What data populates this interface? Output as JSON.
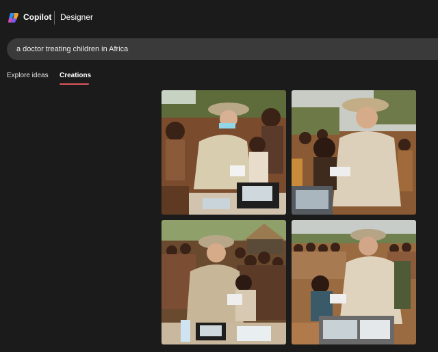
{
  "header": {
    "brand": "Copilot",
    "product": "Designer"
  },
  "prompt": {
    "value": "a doctor treating children in Africa"
  },
  "tabs": [
    {
      "label": "Explore ideas",
      "active": false
    },
    {
      "label": "Creations",
      "active": true
    }
  ],
  "accent_color": "#e0585e",
  "images": [
    {
      "icon": "generated-image"
    },
    {
      "icon": "generated-image"
    },
    {
      "icon": "generated-image"
    },
    {
      "icon": "generated-image"
    }
  ]
}
